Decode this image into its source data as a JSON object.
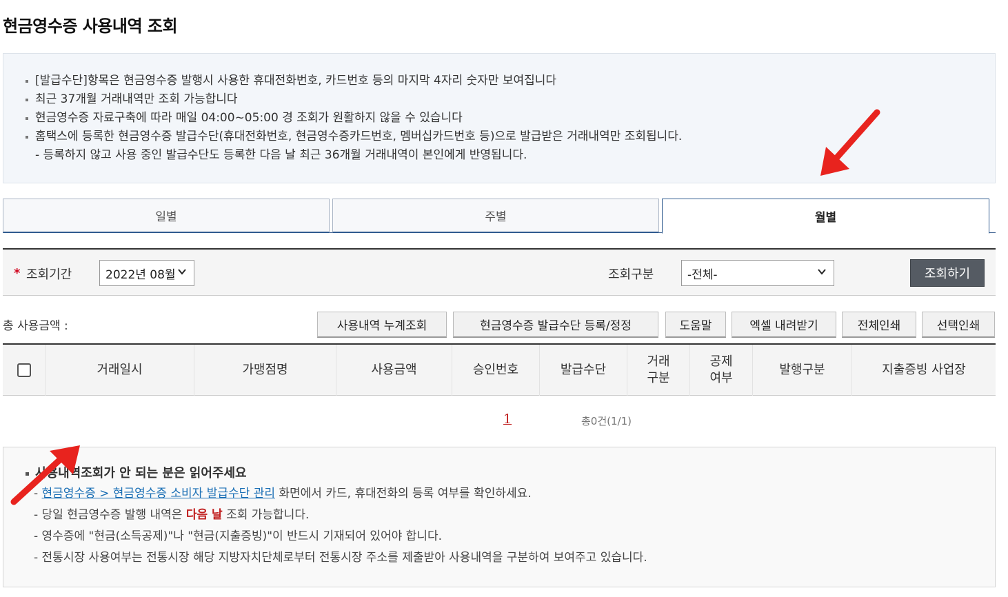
{
  "page": {
    "title": "현금영수증 사용내역 조회"
  },
  "notice": {
    "items": [
      "[발급수단]항목은 현금영수증 발행시 사용한 휴대전화번호, 카드번호 등의 마지막 4자리 숫자만 보여집니다",
      "최근 37개월 거래내역만 조회 가능합니다",
      "현금영수증 자료구축에 따라 매일 04:00~05:00 경 조회가 원활하지 않을 수 있습니다",
      "홈택스에 등록한 현금영수증 발급수단(휴대전화번호, 현금영수증카드번호, 멤버십카드번호 등)으로 발급받은 거래내역만 조회됩니다."
    ],
    "sub_item": "- 등록하지 않고 사용 중인 발급수단도 등록한 다음 날 최근 36개월 거래내역이 본인에게 반영됩니다."
  },
  "tabs": [
    {
      "label": "일별",
      "active": false
    },
    {
      "label": "주별",
      "active": false
    },
    {
      "label": "월별",
      "active": true
    }
  ],
  "search": {
    "required_mark": "*",
    "period_label": "조회기간",
    "period_value": "2022년 08월",
    "type_label": "조회구분",
    "type_value": "-전체-",
    "submit_label": "조회하기"
  },
  "toolbar": {
    "total_label": "총 사용금액 :",
    "buttons": [
      "사용내역 누계조회",
      "현금영수증 발급수단 등록/정정",
      "도움말",
      "엑셀 내려받기",
      "전체인쇄",
      "선택인쇄"
    ]
  },
  "table": {
    "columns": [
      "거래일시",
      "가맹점명",
      "사용금액",
      "승인번호",
      "발급수단",
      "거래\n구분",
      "공제\n여부",
      "발행구분",
      "지출증빙 사업장"
    ]
  },
  "pagination": {
    "current_page": "1",
    "summary": "총0건(1/1)"
  },
  "help": {
    "title": "사용내역조회가 안 되는 분은 읽어주세요",
    "line1_prefix": "- ",
    "line1_link": "현금영수증 > 현금영수증 소비자 발급수단 관리",
    "line1_suffix": " 화면에서 카드, 휴대전화의 등록 여부를 확인하세요.",
    "line2_prefix": "- 당일 현금영수증 발행 내역은 ",
    "line2_highlight": "다음 날",
    "line2_suffix": " 조회 가능합니다.",
    "line3": "- 영수증에 \"현금(소득공제)\"나 \"현금(지출증빙)\"이 반드시 기재되어 있어야 합니다.",
    "line4": "- 전통시장 사용여부는 전통시장 해당 지방자치단체로부터 전통시장 주소를 제출받아 사용내역을 구분하여 보여주고 있습니다."
  },
  "colors": {
    "annotation_arrow": "#e8231e",
    "tab_border": "#2f5a8f",
    "link": "#1b6fb5",
    "highlight": "#c01f1f"
  }
}
